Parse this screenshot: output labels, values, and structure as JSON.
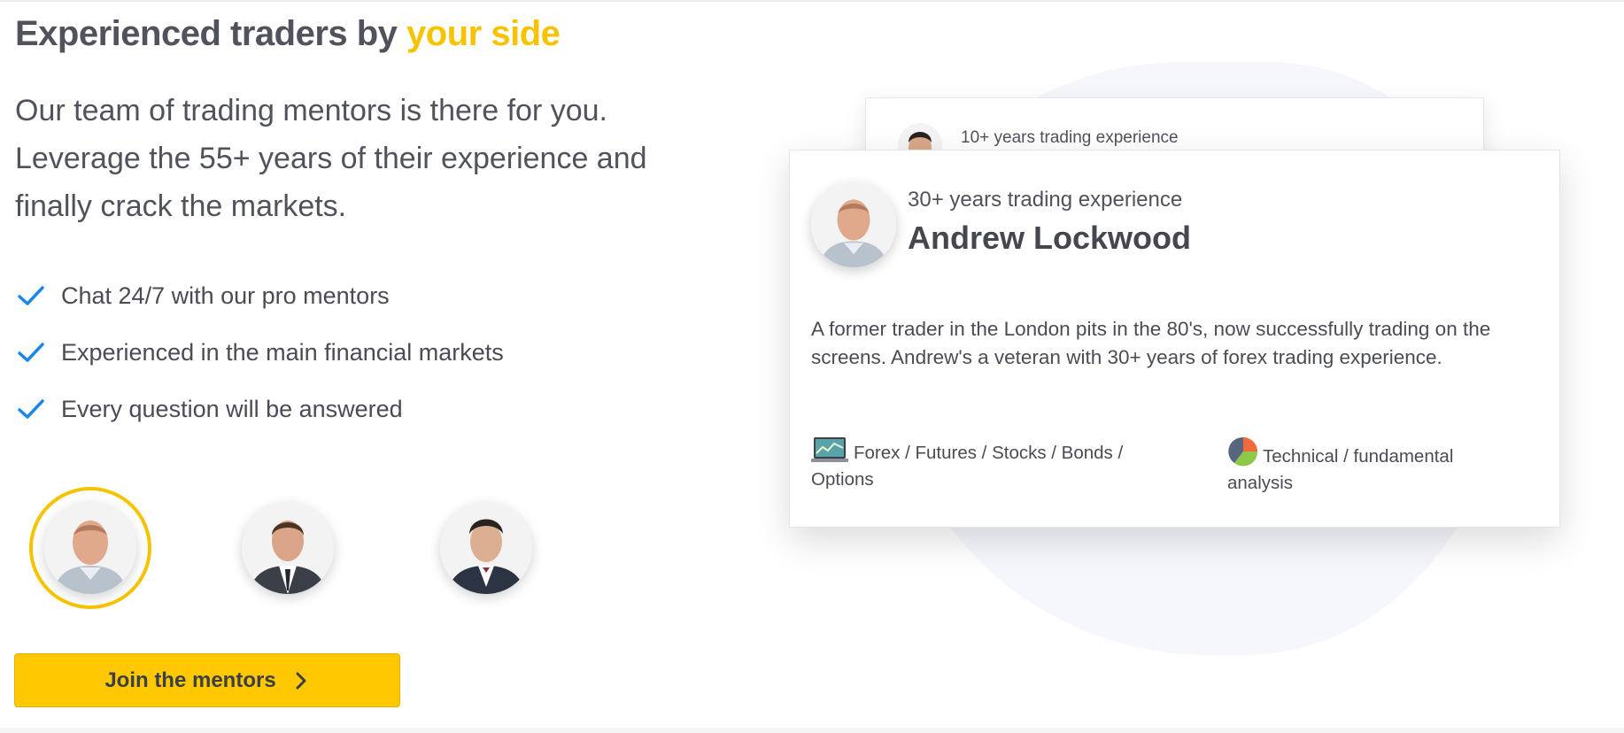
{
  "headline": {
    "part1": "Experienced traders by ",
    "accent": "your side"
  },
  "intro": "Our team of trading mentors is there for you. Leverage the 55+ years of their experience and finally crack the markets.",
  "benefits": [
    {
      "icon": "check-icon",
      "label": "Chat 24/7 with our pro mentors"
    },
    {
      "icon": "check-icon",
      "label": "Experienced in the main financial markets"
    },
    {
      "icon": "check-icon",
      "label": "Every question will be answered"
    }
  ],
  "mentors": [
    {
      "id": "andrew-lockwood",
      "selected": true
    },
    {
      "id": "mentor-2",
      "selected": false
    },
    {
      "id": "mentor-3",
      "selected": false
    }
  ],
  "cta": {
    "label": "Join the mentors",
    "icon": "chevron-right-icon"
  },
  "card_back": {
    "experience": "10+ years trading experience"
  },
  "card_front": {
    "experience": "30+ years trading experience",
    "name": "Andrew Lockwood",
    "bio": "A former trader in the London pits in the 80's, now successfully trading on the screens. Andrew's a veteran with 30+ years of forex trading experience.",
    "markets": {
      "icon": "chart-laptop-icon",
      "label": "Forex / Futures / Stocks / Bonds / Options"
    },
    "analysis": {
      "icon": "pie-chart-icon",
      "label": "Technical / fundamental analysis"
    }
  },
  "colors": {
    "accent": "#f7c300",
    "button": "#ffc800",
    "check": "#1b86e8",
    "text": "#4a4c55"
  }
}
